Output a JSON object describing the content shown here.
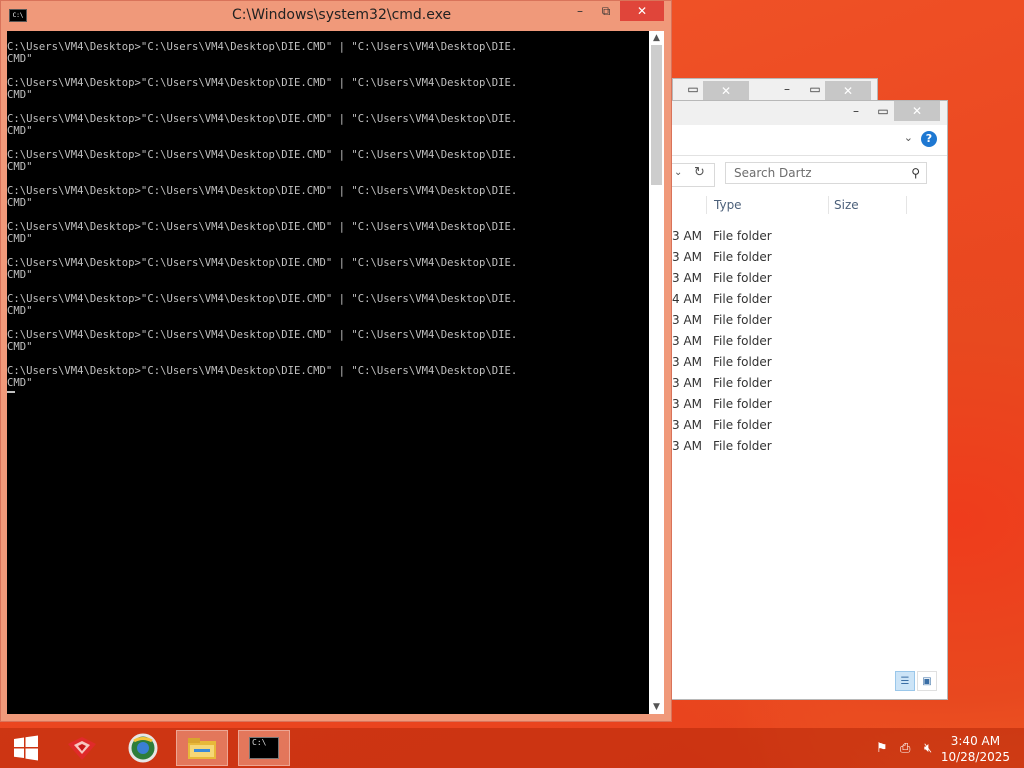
{
  "cmd": {
    "title": "C:\\Windows\\system32\\cmd.exe",
    "lines": [
      "C:\\Users\\VM4\\Desktop>\"C:\\Users\\VM4\\Desktop\\DIE.CMD\" | \"C:\\Users\\VM4\\Desktop\\DIE.",
      "CMD\"",
      "",
      "C:\\Users\\VM4\\Desktop>\"C:\\Users\\VM4\\Desktop\\DIE.CMD\" | \"C:\\Users\\VM4\\Desktop\\DIE.",
      "CMD\"",
      "",
      "C:\\Users\\VM4\\Desktop>\"C:\\Users\\VM4\\Desktop\\DIE.CMD\" | \"C:\\Users\\VM4\\Desktop\\DIE.",
      "CMD\"",
      "",
      "C:\\Users\\VM4\\Desktop>\"C:\\Users\\VM4\\Desktop\\DIE.CMD\" | \"C:\\Users\\VM4\\Desktop\\DIE.",
      "CMD\"",
      "",
      "C:\\Users\\VM4\\Desktop>\"C:\\Users\\VM4\\Desktop\\DIE.CMD\" | \"C:\\Users\\VM4\\Desktop\\DIE.",
      "CMD\"",
      "",
      "C:\\Users\\VM4\\Desktop>\"C:\\Users\\VM4\\Desktop\\DIE.CMD\" | \"C:\\Users\\VM4\\Desktop\\DIE.",
      "CMD\"",
      "",
      "C:\\Users\\VM4\\Desktop>\"C:\\Users\\VM4\\Desktop\\DIE.CMD\" | \"C:\\Users\\VM4\\Desktop\\DIE.",
      "CMD\"",
      "",
      "C:\\Users\\VM4\\Desktop>\"C:\\Users\\VM4\\Desktop\\DIE.CMD\" | \"C:\\Users\\VM4\\Desktop\\DIE.",
      "CMD\"",
      "",
      "C:\\Users\\VM4\\Desktop>\"C:\\Users\\VM4\\Desktop\\DIE.CMD\" | \"C:\\Users\\VM4\\Desktop\\DIE.",
      "CMD\"",
      "",
      "C:\\Users\\VM4\\Desktop>\"C:\\Users\\VM4\\Desktop\\DIE.CMD\" | \"C:\\Users\\VM4\\Desktop\\DIE.",
      "CMD\""
    ],
    "icon_text": "C:\\",
    "minimize": "–",
    "restore": "⧉",
    "close": "✕"
  },
  "explorer": {
    "search_placeholder": "Search Dartz",
    "columns": {
      "type": "Type",
      "size": "Size"
    },
    "rows": [
      {
        "time": "3 AM",
        "type": "File folder"
      },
      {
        "time": "3 AM",
        "type": "File folder"
      },
      {
        "time": "3 AM",
        "type": "File folder"
      },
      {
        "time": "4 AM",
        "type": "File folder"
      },
      {
        "time": "3 AM",
        "type": "File folder"
      },
      {
        "time": "3 AM",
        "type": "File folder"
      },
      {
        "time": "3 AM",
        "type": "File folder"
      },
      {
        "time": "3 AM",
        "type": "File folder"
      },
      {
        "time": "3 AM",
        "type": "File folder"
      },
      {
        "time": "3 AM",
        "type": "File folder"
      },
      {
        "time": "3 AM",
        "type": "File folder"
      }
    ],
    "help": "?",
    "chevron": "⌄"
  },
  "taskbar": {
    "time": "3:40 AM",
    "date": "10/28/2025",
    "items": [
      "start-button",
      "app-red-icon",
      "browser-icon",
      "file-explorer-icon",
      "cmd-icon"
    ]
  },
  "colors": {
    "cmd_frame": "#f0997a",
    "close_red": "#e0453a",
    "console_bg": "#000000",
    "console_text": "#c0c0c0",
    "desktop_accent": "#ec4a22"
  }
}
